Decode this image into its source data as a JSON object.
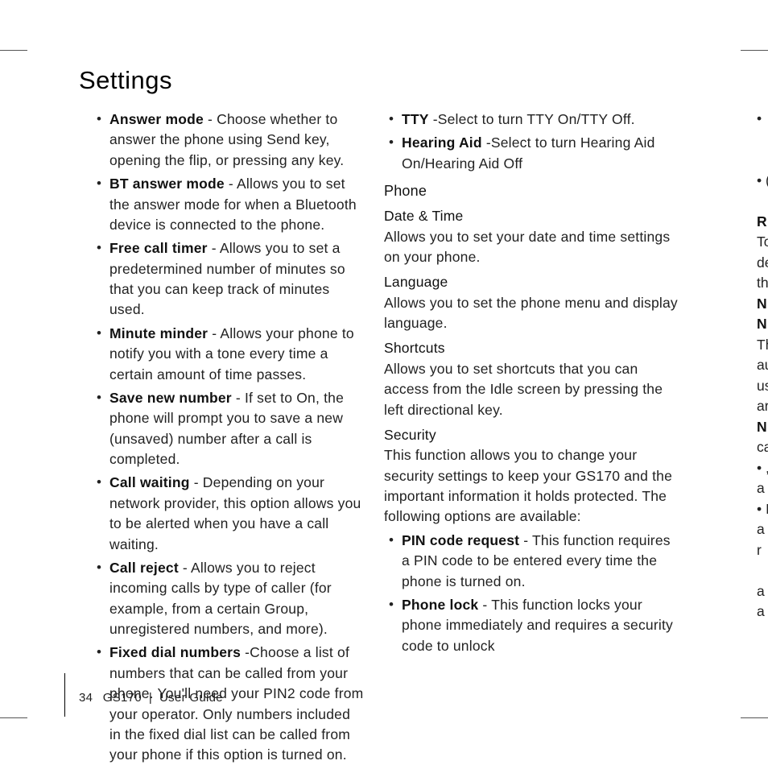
{
  "page_title": "Settings",
  "footer": {
    "page_number": "34",
    "product": "GS170",
    "doc_label": "User Guide"
  },
  "left_items": [
    {
      "bold": "Answer mode",
      "rest": " - Choose whether to answer the phone using Send key, opening the flip, or pressing any key."
    },
    {
      "bold": "BT answer mode",
      "rest": " - Allows you to set the answer mode for when a Bluetooth device is connected to the phone."
    },
    {
      "bold": "Free call timer",
      "rest": " - Allows you to set a predetermined number of minutes so that you can keep track of minutes used."
    },
    {
      "bold": "Minute minder",
      "rest": " - Allows your phone to notify you with a tone every time a certain amount of time passes."
    },
    {
      "bold": "Save new number",
      "rest": " - If set to On, the phone will prompt you to save a new (unsaved) number after a call is completed."
    },
    {
      "bold": "Call waiting",
      "rest": " - Depending on your network provider, this option allows you to be alerted when you have a call waiting."
    },
    {
      "bold": "Call reject",
      "rest": " - Allows you to reject incoming calls by type of caller (for example, from a certain Group, unregistered numbers, and more)."
    },
    {
      "bold": "Fixed dial numbers",
      "rest": " -Choose a list of numbers that can be called from your phone. You'll need your PIN2 code from your operator. Only numbers included in the fixed dial list can be called from your phone if this option is turned on."
    }
  ],
  "right_top_items": [
    {
      "bold": "TTY",
      "rest": " -Select to turn TTY On/TTY Off."
    },
    {
      "bold": "Hearing Aid",
      "rest": " -Select to turn Hearing Aid On/Hearing Aid Off"
    }
  ],
  "sections": {
    "phone_heading": "Phone",
    "date_time": {
      "heading": "Date & Time",
      "body": "Allows you to set your date and time settings on your phone."
    },
    "language": {
      "heading": "Language",
      "body": "Allows you to set the phone menu and display language."
    },
    "shortcuts": {
      "heading": "Shortcuts",
      "body": "Allows you to set shortcuts that you can access from the Idle screen by pressing the left directional key."
    },
    "security": {
      "heading": "Security",
      "body": "This function allows you to change your security settings to keep your GS170 and the important information it holds protected. The following options are available:"
    }
  },
  "security_items": [
    {
      "bold": "PIN code request",
      "rest": " - This function requires a PIN code to be entered every time the phone is turned on."
    },
    {
      "bold": "Phone lock",
      "rest": " - This function locks your phone immediately and requires a security code to unlock"
    }
  ],
  "overflow_fragments": [
    "•",
    "",
    "",
    "• (",
    "",
    "R",
    "To",
    "de",
    "th",
    "N",
    "N",
    "Th",
    "au",
    "us",
    "ar",
    "N",
    "ca",
    "• ,",
    "a",
    "• I",
    "a",
    "r",
    "",
    "a",
    "a"
  ],
  "overflow_bold_indices": [
    5,
    9,
    10,
    15
  ]
}
